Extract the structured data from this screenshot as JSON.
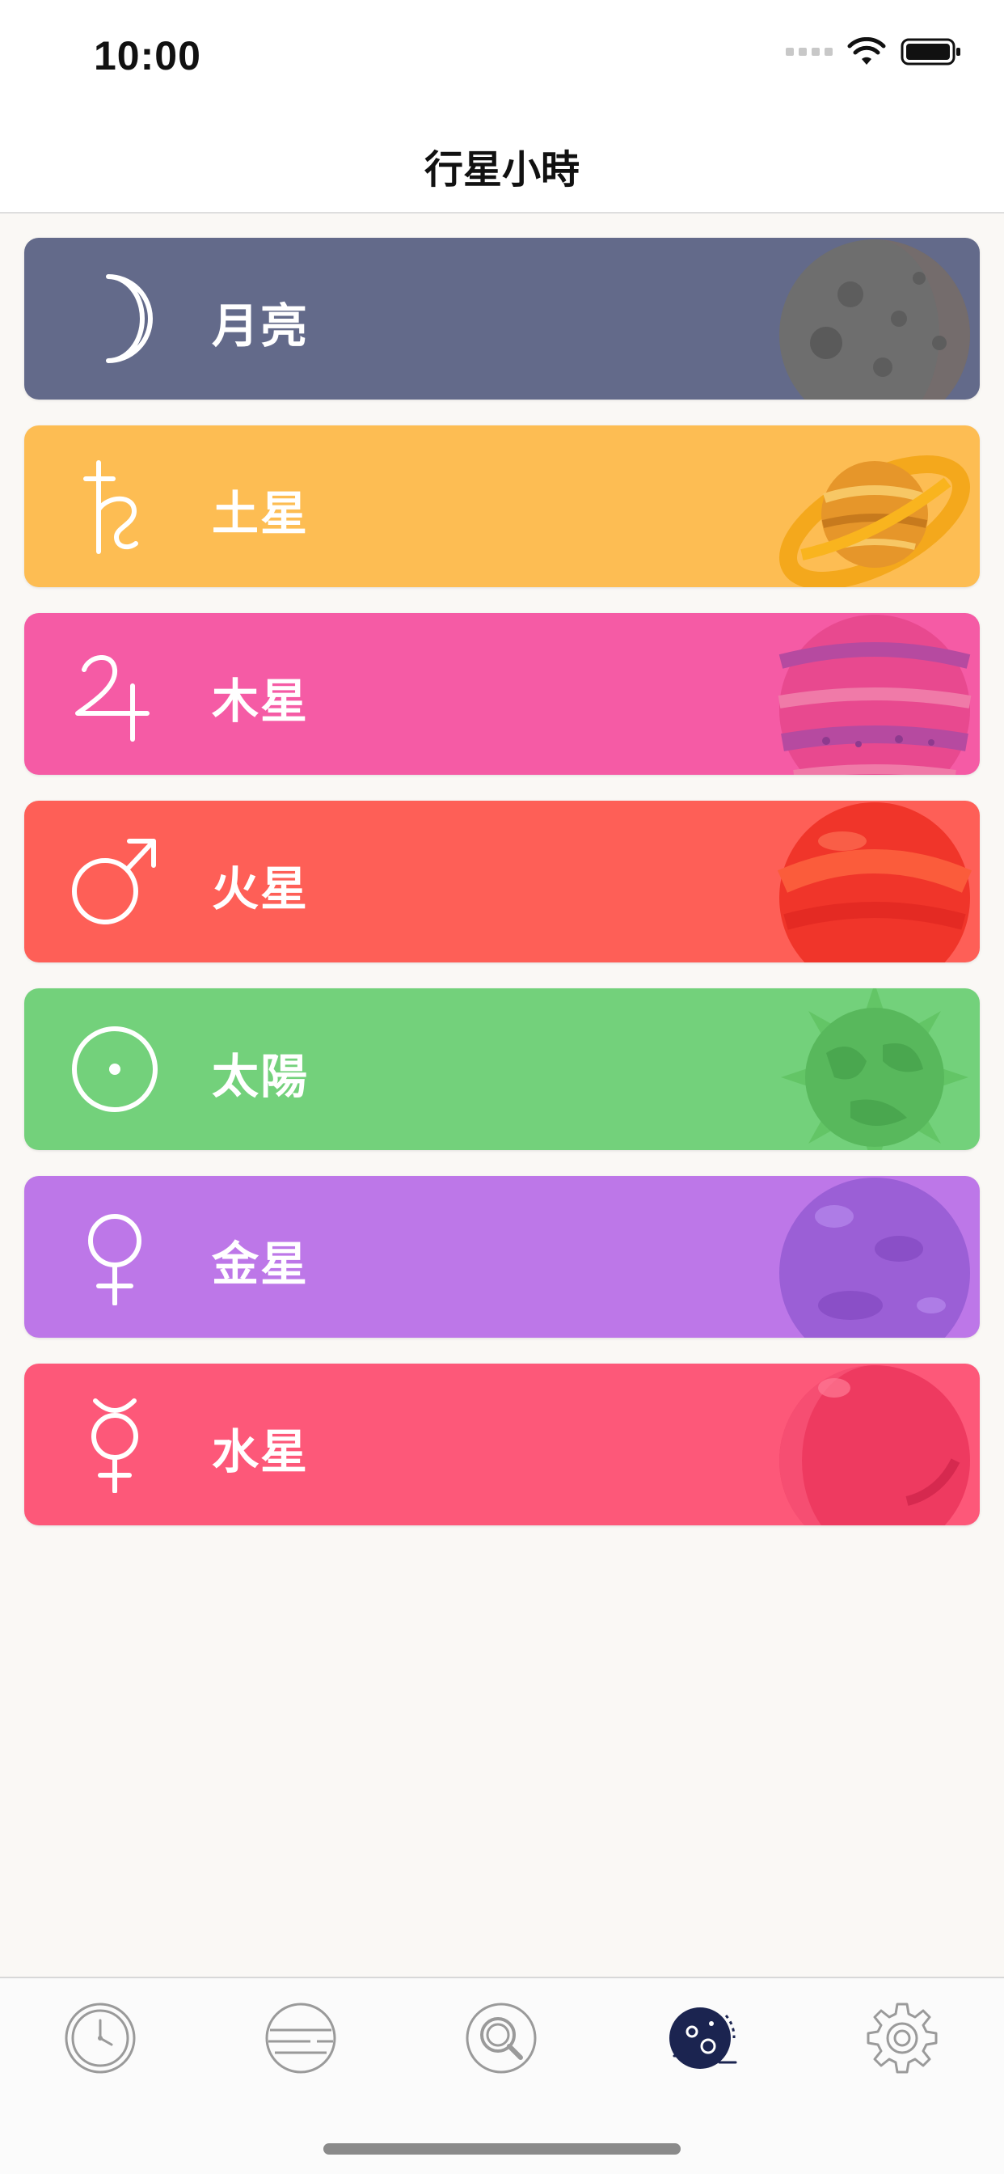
{
  "status_bar": {
    "time": "10:00",
    "icons": [
      "signal-icon",
      "wifi-icon",
      "battery-icon"
    ]
  },
  "nav": {
    "title": "行星小時"
  },
  "planets": [
    {
      "name": "月亮",
      "symbol": "moon-symbol-icon",
      "color": "#636a8a",
      "art": "moon-planet-illustration"
    },
    {
      "name": "土星",
      "symbol": "saturn-symbol-icon",
      "color": "#fdbd53",
      "art": "saturn-planet-illustration"
    },
    {
      "name": "木星",
      "symbol": "jupiter-symbol-icon",
      "color": "#f55ba5",
      "art": "jupiter-planet-illustration"
    },
    {
      "name": "火星",
      "symbol": "mars-symbol-icon",
      "color": "#fe5f57",
      "art": "mars-planet-illustration"
    },
    {
      "name": "太陽",
      "symbol": "sun-symbol-icon",
      "color": "#73d17b",
      "art": "sun-illustration"
    },
    {
      "name": "金星",
      "symbol": "venus-symbol-icon",
      "color": "#bd77e8",
      "art": "venus-planet-illustration"
    },
    {
      "name": "水星",
      "symbol": "mercury-symbol-icon",
      "color": "#fd5879",
      "art": "mercury-planet-illustration"
    }
  ],
  "tab_bar": {
    "tabs": [
      "clock-icon",
      "planet-hours-icon",
      "search-icon",
      "planets-icon",
      "settings-icon"
    ],
    "selected": "planets-icon",
    "selected_color": "#1b2450"
  }
}
